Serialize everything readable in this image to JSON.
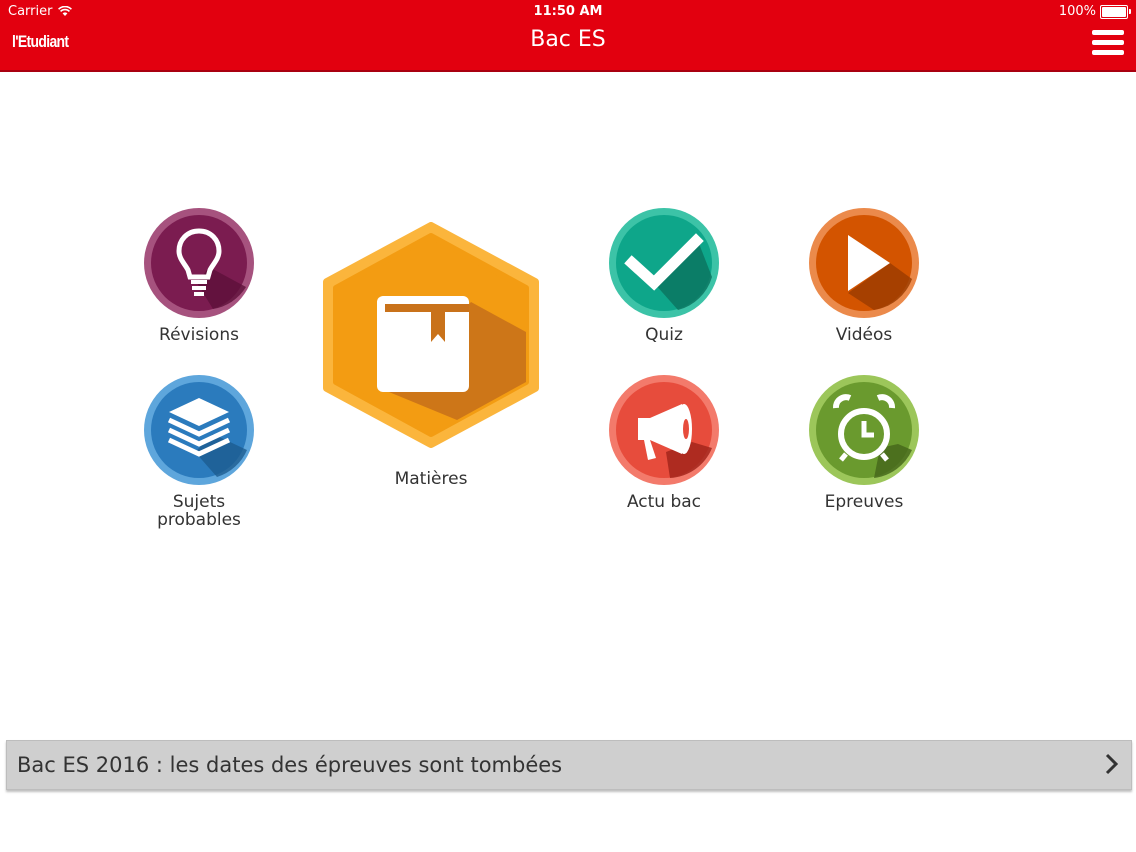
{
  "status_bar": {
    "carrier": "Carrier",
    "time": "11:50 AM",
    "battery": "100%",
    "battery_level": 1.0
  },
  "header": {
    "logo": "l'Etudiant",
    "title": "Bac ES",
    "menu_icon": "hamburger-menu-icon"
  },
  "tiles": {
    "revisions": {
      "label": "Révisions",
      "icon": "lightbulb-icon",
      "color": "#7b1c50"
    },
    "sujets": {
      "label_line1": "Sujets",
      "label_line2": "probables",
      "icon": "layers-icon",
      "color": "#2b7bbd"
    },
    "matieres": {
      "label": "Matières",
      "icon": "book-icon",
      "color": "#f39c12"
    },
    "quiz": {
      "label": "Quiz",
      "icon": "checkmark-icon",
      "color": "#0ea68a"
    },
    "videos": {
      "label": "Vidéos",
      "icon": "play-icon",
      "color": "#d35400"
    },
    "actu": {
      "label": "Actu bac",
      "icon": "megaphone-icon",
      "color": "#e74c3c"
    },
    "epreuves": {
      "label": "Epreuves",
      "icon": "alarm-clock-icon",
      "color": "#6a9a2e"
    }
  },
  "news_banner": {
    "text": "Bac ES 2016 : les dates des épreuves sont tombées",
    "icon": "chevron-right-icon"
  },
  "colors": {
    "brand_red": "#e2000f",
    "banner_gray": "#cfcfcf"
  }
}
